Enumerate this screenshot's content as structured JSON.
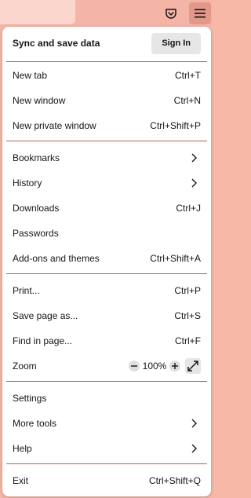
{
  "toolbar": {
    "pocket_icon": "pocket-icon",
    "menu_icon": "hamburger-menu-icon"
  },
  "sync": {
    "label": "Sync and save data",
    "signin_label": "Sign In"
  },
  "group1": [
    {
      "label": "New tab",
      "shortcut": "Ctrl+T"
    },
    {
      "label": "New window",
      "shortcut": "Ctrl+N"
    },
    {
      "label": "New private window",
      "shortcut": "Ctrl+Shift+P"
    }
  ],
  "group2": [
    {
      "label": "Bookmarks",
      "icon": "chevron-right-icon"
    },
    {
      "label": "History",
      "icon": "chevron-right-icon"
    },
    {
      "label": "Downloads",
      "shortcut": "Ctrl+J"
    },
    {
      "label": "Passwords"
    },
    {
      "label": "Add-ons and themes",
      "shortcut": "Ctrl+Shift+A"
    }
  ],
  "group3": [
    {
      "label": "Print...",
      "shortcut": "Ctrl+P"
    },
    {
      "label": "Save page as...",
      "shortcut": "Ctrl+S"
    },
    {
      "label": "Find in page...",
      "shortcut": "Ctrl+F"
    }
  ],
  "zoom": {
    "label": "Zoom",
    "value": "100%",
    "minus_icon": "minus-icon",
    "plus_icon": "plus-icon",
    "fullscreen_icon": "fullscreen-icon"
  },
  "group4": [
    {
      "label": "Settings"
    },
    {
      "label": "More tools",
      "icon": "chevron-right-icon"
    },
    {
      "label": "Help",
      "icon": "chevron-right-icon"
    }
  ],
  "exit": {
    "label": "Exit",
    "shortcut": "Ctrl+Shift+Q"
  },
  "colors": {
    "toolbar_bg": "#f4b5a6",
    "separator": "#c25a4a",
    "panel_bg": "#ffffff"
  }
}
